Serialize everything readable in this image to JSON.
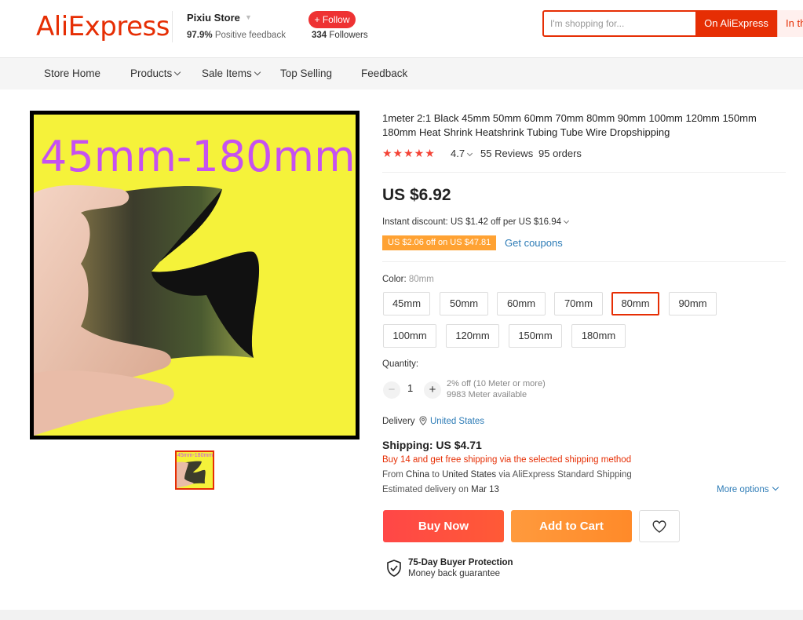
{
  "header": {
    "logo": "AliExpress",
    "store_name": "Pixiu Store",
    "positive_value": "97.9%",
    "positive_label": "Positive feedback",
    "follow_label": "+ Follow",
    "followers_count": "334",
    "followers_label": "Followers",
    "search_placeholder": "I'm shopping for...",
    "search_button": "On AliExpress",
    "search_button2": "In th"
  },
  "nav": {
    "items": [
      {
        "label": "Store Home"
      },
      {
        "label": "Products"
      },
      {
        "label": "Sale Items"
      },
      {
        "label": "Top Selling"
      },
      {
        "label": "Feedback"
      }
    ]
  },
  "product": {
    "image_text": "45mm-180mm",
    "thumb_text": "45mm-180mm",
    "title": "1meter 2:1 Black 45mm 50mm 60mm 70mm 80mm 90mm 100mm 120mm 150mm 180mm Heat Shrink Heatshrink Tubing Tube Wire Dropshipping",
    "stars": "★★★★★",
    "rating": "4.7",
    "reviews": "55 Reviews",
    "orders": "95 orders",
    "price": "US $6.92",
    "instant_discount": "Instant discount: US $1.42 off per US $16.94",
    "coupon_tag": "US $2.06 off on US $47.81",
    "get_coupons": "Get coupons",
    "color_label": "Color:",
    "color_selected": "80mm",
    "options": [
      "45mm",
      "50mm",
      "60mm",
      "70mm",
      "80mm",
      "90mm",
      "100mm",
      "120mm",
      "150mm",
      "180mm"
    ],
    "quantity_label": "Quantity:",
    "quantity_value": "1",
    "minus": "−",
    "plus": "+",
    "qty_discount": "2% off (10 Meter or more)",
    "qty_available": "9983 Meter available",
    "delivery_label": "Delivery",
    "delivery_location": "United States",
    "shipping": "Shipping: US $4.71",
    "shipping_promo": "Buy 14 and get free shipping via the selected shipping method",
    "ship_from_prefix": "From",
    "ship_from_country": "China",
    "ship_to_word": "to",
    "ship_to_country": "United States",
    "ship_via": "via AliExpress Standard Shipping",
    "est_prefix": "Estimated delivery on",
    "est_date": "Mar 13",
    "more_options": "More options",
    "buy_now": "Buy Now",
    "add_to_cart": "Add to Cart",
    "protection_title": "75-Day Buyer Protection",
    "protection_sub": "Money back guarantee"
  },
  "colors": {
    "brand": "#e62e04",
    "star": "#f44336",
    "link": "#2c7bb6",
    "coupon": "#ffa233",
    "image_bg": "#f5f23a",
    "image_text": "#c651f0"
  }
}
